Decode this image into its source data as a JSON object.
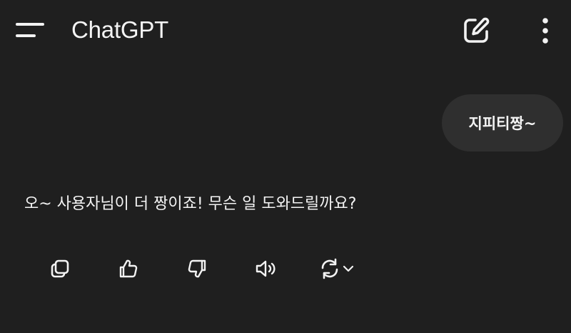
{
  "header": {
    "title": "ChatGPT",
    "menu_icon": "menu-icon",
    "new_chat_icon": "new-chat-icon",
    "more_icon": "more-vertical-icon"
  },
  "conversation": {
    "user_message": "지피티짱~",
    "assistant_message": "오~ 사용자님이 더 짱이죠! 무슨 일 도와드릴까요?"
  },
  "actions": {
    "icons": [
      "copy-icon",
      "thumbs-up-icon",
      "thumbs-down-icon",
      "speaker-icon",
      "regenerate-icon",
      "chevron-down-icon"
    ]
  },
  "colors": {
    "background": "#1f1f1f",
    "bubble": "#2f2f2f",
    "text": "#f4f4f4"
  }
}
